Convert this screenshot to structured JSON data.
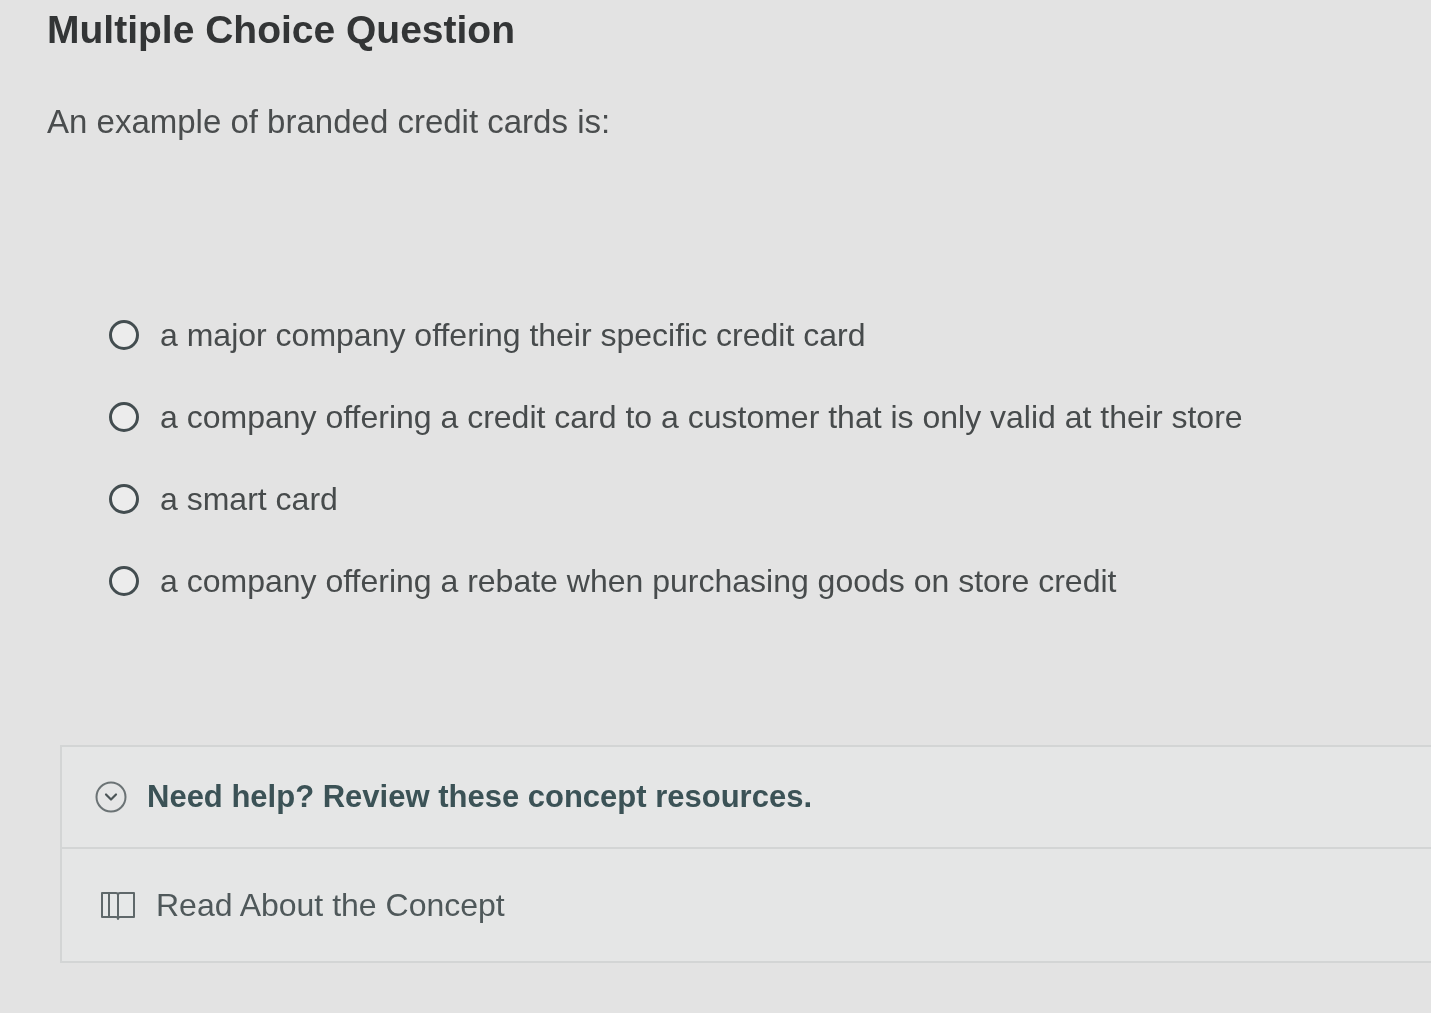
{
  "title": "Multiple Choice Question",
  "question": "An example of branded credit cards is:",
  "options": [
    {
      "label": "a major company offering their specific credit card",
      "selected": false
    },
    {
      "label": "a company offering a credit card to a customer that is only valid at their store",
      "selected": false
    },
    {
      "label": "a smart card",
      "selected": false
    },
    {
      "label": "a company offering a rebate when purchasing goods on store credit",
      "selected": false
    }
  ],
  "help": {
    "heading": "Need help? Review these concept resources.",
    "expanded": true,
    "resources": [
      {
        "label": "Read About the Concept"
      }
    ]
  }
}
